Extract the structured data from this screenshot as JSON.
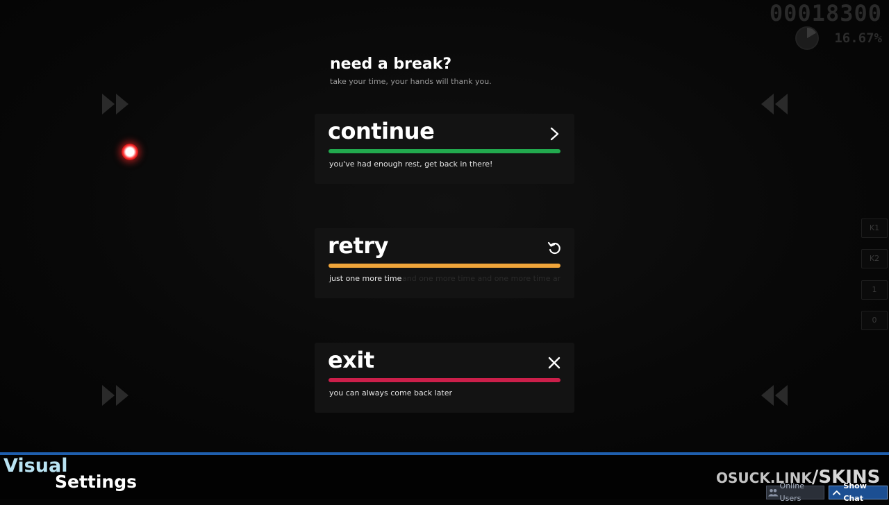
{
  "hud": {
    "score": "00018300",
    "accuracy": "16.67%",
    "accuracy_fraction": 0.1667,
    "keys": [
      "K1",
      "K2",
      "1",
      "0"
    ]
  },
  "pause_menu": {
    "title": "need a break?",
    "subtitle": "take your time, your hands will thank you.",
    "buttons": [
      {
        "label": "continue",
        "description": "you've had enough rest, get back in there!",
        "icon": "chevron-right-icon",
        "color": "#22a94e"
      },
      {
        "label": "retry",
        "description": "just one more time",
        "description_echo": "and one more time and one more time and one more time",
        "icon": "retry-icon",
        "color": "#f0a53a"
      },
      {
        "label": "exit",
        "description": "you can always come back later",
        "icon": "close-icon",
        "color": "#cc1f4a"
      }
    ]
  },
  "footer": {
    "visual_label": "Visual",
    "settings_label": "Settings",
    "watermark_prefix": "OSUCK.LINK",
    "watermark_suffix": "/SKINS",
    "online_users_label": "Online Users",
    "show_chat_label": "Show Chat",
    "accent_color": "#1f5fae"
  }
}
